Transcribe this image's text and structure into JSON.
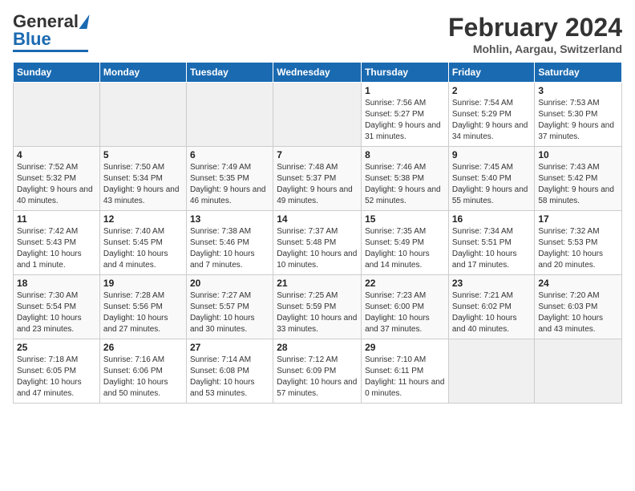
{
  "logo": {
    "general": "General",
    "blue": "Blue"
  },
  "header": {
    "title": "February 2024",
    "location": "Mohlin, Aargau, Switzerland"
  },
  "weekdays": [
    "Sunday",
    "Monday",
    "Tuesday",
    "Wednesday",
    "Thursday",
    "Friday",
    "Saturday"
  ],
  "weeks": [
    [
      {
        "day": null
      },
      {
        "day": null
      },
      {
        "day": null
      },
      {
        "day": null
      },
      {
        "day": "1",
        "sunrise": "7:56 AM",
        "sunset": "5:27 PM",
        "daylight": "9 hours and 31 minutes."
      },
      {
        "day": "2",
        "sunrise": "7:54 AM",
        "sunset": "5:29 PM",
        "daylight": "9 hours and 34 minutes."
      },
      {
        "day": "3",
        "sunrise": "7:53 AM",
        "sunset": "5:30 PM",
        "daylight": "9 hours and 37 minutes."
      }
    ],
    [
      {
        "day": "4",
        "sunrise": "7:52 AM",
        "sunset": "5:32 PM",
        "daylight": "9 hours and 40 minutes."
      },
      {
        "day": "5",
        "sunrise": "7:50 AM",
        "sunset": "5:34 PM",
        "daylight": "9 hours and 43 minutes."
      },
      {
        "day": "6",
        "sunrise": "7:49 AM",
        "sunset": "5:35 PM",
        "daylight": "9 hours and 46 minutes."
      },
      {
        "day": "7",
        "sunrise": "7:48 AM",
        "sunset": "5:37 PM",
        "daylight": "9 hours and 49 minutes."
      },
      {
        "day": "8",
        "sunrise": "7:46 AM",
        "sunset": "5:38 PM",
        "daylight": "9 hours and 52 minutes."
      },
      {
        "day": "9",
        "sunrise": "7:45 AM",
        "sunset": "5:40 PM",
        "daylight": "9 hours and 55 minutes."
      },
      {
        "day": "10",
        "sunrise": "7:43 AM",
        "sunset": "5:42 PM",
        "daylight": "9 hours and 58 minutes."
      }
    ],
    [
      {
        "day": "11",
        "sunrise": "7:42 AM",
        "sunset": "5:43 PM",
        "daylight": "10 hours and 1 minute."
      },
      {
        "day": "12",
        "sunrise": "7:40 AM",
        "sunset": "5:45 PM",
        "daylight": "10 hours and 4 minutes."
      },
      {
        "day": "13",
        "sunrise": "7:38 AM",
        "sunset": "5:46 PM",
        "daylight": "10 hours and 7 minutes."
      },
      {
        "day": "14",
        "sunrise": "7:37 AM",
        "sunset": "5:48 PM",
        "daylight": "10 hours and 10 minutes."
      },
      {
        "day": "15",
        "sunrise": "7:35 AM",
        "sunset": "5:49 PM",
        "daylight": "10 hours and 14 minutes."
      },
      {
        "day": "16",
        "sunrise": "7:34 AM",
        "sunset": "5:51 PM",
        "daylight": "10 hours and 17 minutes."
      },
      {
        "day": "17",
        "sunrise": "7:32 AM",
        "sunset": "5:53 PM",
        "daylight": "10 hours and 20 minutes."
      }
    ],
    [
      {
        "day": "18",
        "sunrise": "7:30 AM",
        "sunset": "5:54 PM",
        "daylight": "10 hours and 23 minutes."
      },
      {
        "day": "19",
        "sunrise": "7:28 AM",
        "sunset": "5:56 PM",
        "daylight": "10 hours and 27 minutes."
      },
      {
        "day": "20",
        "sunrise": "7:27 AM",
        "sunset": "5:57 PM",
        "daylight": "10 hours and 30 minutes."
      },
      {
        "day": "21",
        "sunrise": "7:25 AM",
        "sunset": "5:59 PM",
        "daylight": "10 hours and 33 minutes."
      },
      {
        "day": "22",
        "sunrise": "7:23 AM",
        "sunset": "6:00 PM",
        "daylight": "10 hours and 37 minutes."
      },
      {
        "day": "23",
        "sunrise": "7:21 AM",
        "sunset": "6:02 PM",
        "daylight": "10 hours and 40 minutes."
      },
      {
        "day": "24",
        "sunrise": "7:20 AM",
        "sunset": "6:03 PM",
        "daylight": "10 hours and 43 minutes."
      }
    ],
    [
      {
        "day": "25",
        "sunrise": "7:18 AM",
        "sunset": "6:05 PM",
        "daylight": "10 hours and 47 minutes."
      },
      {
        "day": "26",
        "sunrise": "7:16 AM",
        "sunset": "6:06 PM",
        "daylight": "10 hours and 50 minutes."
      },
      {
        "day": "27",
        "sunrise": "7:14 AM",
        "sunset": "6:08 PM",
        "daylight": "10 hours and 53 minutes."
      },
      {
        "day": "28",
        "sunrise": "7:12 AM",
        "sunset": "6:09 PM",
        "daylight": "10 hours and 57 minutes."
      },
      {
        "day": "29",
        "sunrise": "7:10 AM",
        "sunset": "6:11 PM",
        "daylight": "11 hours and 0 minutes."
      },
      {
        "day": null
      },
      {
        "day": null
      }
    ]
  ]
}
